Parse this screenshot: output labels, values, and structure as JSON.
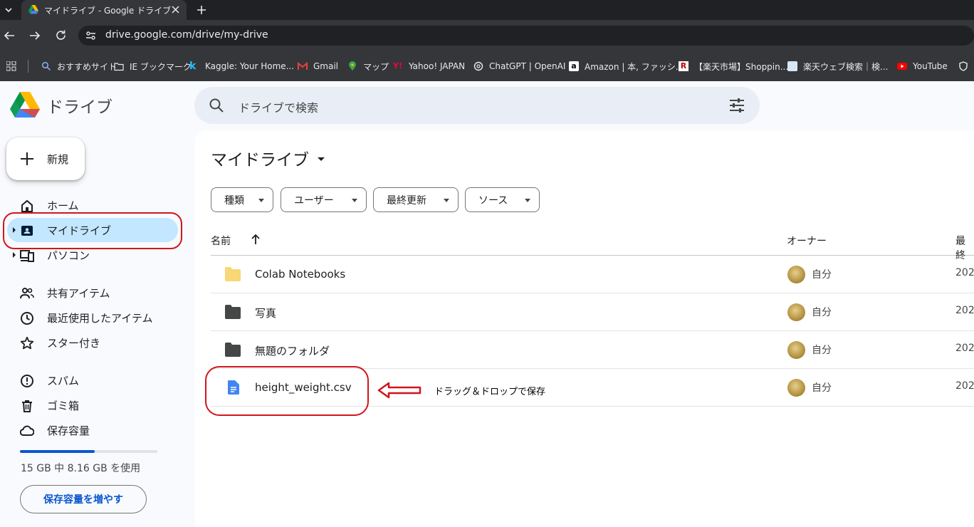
{
  "browser": {
    "tab_title": "マイドライブ - Google ドライブ",
    "url": "drive.google.com/drive/my-drive",
    "bookmarks": [
      {
        "label": "おすすめサイト",
        "icon": "search-icon"
      },
      {
        "label": "IE ブックマーク",
        "icon": "folder-icon"
      },
      {
        "label": "Kaggle: Your Home...",
        "icon": "kaggle-icon"
      },
      {
        "label": "Gmail",
        "icon": "gmail-icon"
      },
      {
        "label": "マップ",
        "icon": "maps-icon"
      },
      {
        "label": "Yahoo! JAPAN",
        "icon": "yahoo-icon"
      },
      {
        "label": "ChatGPT | OpenAI",
        "icon": "openai-icon"
      },
      {
        "label": "Amazon | 本, ファッシ...",
        "icon": "amazon-icon"
      },
      {
        "label": "【楽天市場】Shoppin...",
        "icon": "rakuten-icon"
      },
      {
        "label": "楽天ウェブ検索｜検...",
        "icon": "rakuten-search-icon"
      },
      {
        "label": "YouTube",
        "icon": "youtube-icon"
      }
    ]
  },
  "app": {
    "name": "ドライブ"
  },
  "search": {
    "placeholder": "ドライブで検索"
  },
  "sidebar": {
    "new_label": "新規",
    "items": [
      {
        "label": "ホーム",
        "icon": "home-icon"
      },
      {
        "label": "マイドライブ",
        "icon": "my-drive-icon",
        "selected": true
      },
      {
        "label": "パソコン",
        "icon": "computers-icon"
      },
      {
        "label": "共有アイテム",
        "icon": "shared-icon"
      },
      {
        "label": "最近使用したアイテム",
        "icon": "clock-icon"
      },
      {
        "label": "スター付き",
        "icon": "star-icon"
      },
      {
        "label": "スパム",
        "icon": "spam-icon"
      },
      {
        "label": "ゴミ箱",
        "icon": "trash-icon"
      },
      {
        "label": "保存容量",
        "icon": "cloud-icon"
      }
    ],
    "storage_used_fraction": 0.544,
    "storage_text": "15 GB 中 8.16 GB を使用",
    "storage_button": "保存容量を増やす"
  },
  "main": {
    "title": "マイドライブ",
    "filters": [
      "種類",
      "ユーザー",
      "最終更新",
      "ソース"
    ],
    "columns": {
      "name": "名前",
      "owner": "オーナー",
      "modified": "最終"
    },
    "files": [
      {
        "name": "Colab Notebooks",
        "type": "folder",
        "color": "#f8d775",
        "owner": "自分",
        "modified": "202"
      },
      {
        "name": "写真",
        "type": "folder",
        "color": "#444746",
        "owner": "自分",
        "modified": "202"
      },
      {
        "name": "無題のフォルダ",
        "type": "folder",
        "color": "#444746",
        "owner": "自分",
        "modified": "202"
      },
      {
        "name": "height_weight.csv",
        "type": "doc",
        "color": "#4285f4",
        "owner": "自分",
        "modified": "202"
      }
    ],
    "annotation": "ドラッグ＆ドロップで保存"
  },
  "colors": {
    "accent": "#0b57d0",
    "selected_bg": "#c2e7ff",
    "highlight_red": "#d0161b"
  }
}
